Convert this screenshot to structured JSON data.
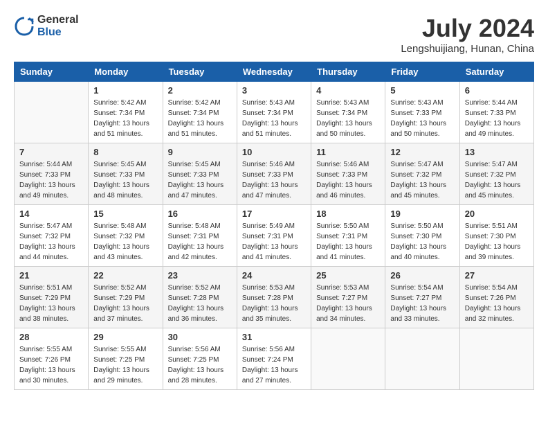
{
  "header": {
    "logo_general": "General",
    "logo_blue": "Blue",
    "month_year": "July 2024",
    "location": "Lengshuijiang, Hunan, China"
  },
  "weekdays": [
    "Sunday",
    "Monday",
    "Tuesday",
    "Wednesday",
    "Thursday",
    "Friday",
    "Saturday"
  ],
  "weeks": [
    [
      {
        "num": "",
        "sunrise": "",
        "sunset": "",
        "daylight": ""
      },
      {
        "num": "1",
        "sunrise": "Sunrise: 5:42 AM",
        "sunset": "Sunset: 7:34 PM",
        "daylight": "Daylight: 13 hours and 51 minutes."
      },
      {
        "num": "2",
        "sunrise": "Sunrise: 5:42 AM",
        "sunset": "Sunset: 7:34 PM",
        "daylight": "Daylight: 13 hours and 51 minutes."
      },
      {
        "num": "3",
        "sunrise": "Sunrise: 5:43 AM",
        "sunset": "Sunset: 7:34 PM",
        "daylight": "Daylight: 13 hours and 51 minutes."
      },
      {
        "num": "4",
        "sunrise": "Sunrise: 5:43 AM",
        "sunset": "Sunset: 7:34 PM",
        "daylight": "Daylight: 13 hours and 50 minutes."
      },
      {
        "num": "5",
        "sunrise": "Sunrise: 5:43 AM",
        "sunset": "Sunset: 7:33 PM",
        "daylight": "Daylight: 13 hours and 50 minutes."
      },
      {
        "num": "6",
        "sunrise": "Sunrise: 5:44 AM",
        "sunset": "Sunset: 7:33 PM",
        "daylight": "Daylight: 13 hours and 49 minutes."
      }
    ],
    [
      {
        "num": "7",
        "sunrise": "Sunrise: 5:44 AM",
        "sunset": "Sunset: 7:33 PM",
        "daylight": "Daylight: 13 hours and 49 minutes."
      },
      {
        "num": "8",
        "sunrise": "Sunrise: 5:45 AM",
        "sunset": "Sunset: 7:33 PM",
        "daylight": "Daylight: 13 hours and 48 minutes."
      },
      {
        "num": "9",
        "sunrise": "Sunrise: 5:45 AM",
        "sunset": "Sunset: 7:33 PM",
        "daylight": "Daylight: 13 hours and 47 minutes."
      },
      {
        "num": "10",
        "sunrise": "Sunrise: 5:46 AM",
        "sunset": "Sunset: 7:33 PM",
        "daylight": "Daylight: 13 hours and 47 minutes."
      },
      {
        "num": "11",
        "sunrise": "Sunrise: 5:46 AM",
        "sunset": "Sunset: 7:33 PM",
        "daylight": "Daylight: 13 hours and 46 minutes."
      },
      {
        "num": "12",
        "sunrise": "Sunrise: 5:47 AM",
        "sunset": "Sunset: 7:32 PM",
        "daylight": "Daylight: 13 hours and 45 minutes."
      },
      {
        "num": "13",
        "sunrise": "Sunrise: 5:47 AM",
        "sunset": "Sunset: 7:32 PM",
        "daylight": "Daylight: 13 hours and 45 minutes."
      }
    ],
    [
      {
        "num": "14",
        "sunrise": "Sunrise: 5:47 AM",
        "sunset": "Sunset: 7:32 PM",
        "daylight": "Daylight: 13 hours and 44 minutes."
      },
      {
        "num": "15",
        "sunrise": "Sunrise: 5:48 AM",
        "sunset": "Sunset: 7:32 PM",
        "daylight": "Daylight: 13 hours and 43 minutes."
      },
      {
        "num": "16",
        "sunrise": "Sunrise: 5:48 AM",
        "sunset": "Sunset: 7:31 PM",
        "daylight": "Daylight: 13 hours and 42 minutes."
      },
      {
        "num": "17",
        "sunrise": "Sunrise: 5:49 AM",
        "sunset": "Sunset: 7:31 PM",
        "daylight": "Daylight: 13 hours and 41 minutes."
      },
      {
        "num": "18",
        "sunrise": "Sunrise: 5:50 AM",
        "sunset": "Sunset: 7:31 PM",
        "daylight": "Daylight: 13 hours and 41 minutes."
      },
      {
        "num": "19",
        "sunrise": "Sunrise: 5:50 AM",
        "sunset": "Sunset: 7:30 PM",
        "daylight": "Daylight: 13 hours and 40 minutes."
      },
      {
        "num": "20",
        "sunrise": "Sunrise: 5:51 AM",
        "sunset": "Sunset: 7:30 PM",
        "daylight": "Daylight: 13 hours and 39 minutes."
      }
    ],
    [
      {
        "num": "21",
        "sunrise": "Sunrise: 5:51 AM",
        "sunset": "Sunset: 7:29 PM",
        "daylight": "Daylight: 13 hours and 38 minutes."
      },
      {
        "num": "22",
        "sunrise": "Sunrise: 5:52 AM",
        "sunset": "Sunset: 7:29 PM",
        "daylight": "Daylight: 13 hours and 37 minutes."
      },
      {
        "num": "23",
        "sunrise": "Sunrise: 5:52 AM",
        "sunset": "Sunset: 7:28 PM",
        "daylight": "Daylight: 13 hours and 36 minutes."
      },
      {
        "num": "24",
        "sunrise": "Sunrise: 5:53 AM",
        "sunset": "Sunset: 7:28 PM",
        "daylight": "Daylight: 13 hours and 35 minutes."
      },
      {
        "num": "25",
        "sunrise": "Sunrise: 5:53 AM",
        "sunset": "Sunset: 7:27 PM",
        "daylight": "Daylight: 13 hours and 34 minutes."
      },
      {
        "num": "26",
        "sunrise": "Sunrise: 5:54 AM",
        "sunset": "Sunset: 7:27 PM",
        "daylight": "Daylight: 13 hours and 33 minutes."
      },
      {
        "num": "27",
        "sunrise": "Sunrise: 5:54 AM",
        "sunset": "Sunset: 7:26 PM",
        "daylight": "Daylight: 13 hours and 32 minutes."
      }
    ],
    [
      {
        "num": "28",
        "sunrise": "Sunrise: 5:55 AM",
        "sunset": "Sunset: 7:26 PM",
        "daylight": "Daylight: 13 hours and 30 minutes."
      },
      {
        "num": "29",
        "sunrise": "Sunrise: 5:55 AM",
        "sunset": "Sunset: 7:25 PM",
        "daylight": "Daylight: 13 hours and 29 minutes."
      },
      {
        "num": "30",
        "sunrise": "Sunrise: 5:56 AM",
        "sunset": "Sunset: 7:25 PM",
        "daylight": "Daylight: 13 hours and 28 minutes."
      },
      {
        "num": "31",
        "sunrise": "Sunrise: 5:56 AM",
        "sunset": "Sunset: 7:24 PM",
        "daylight": "Daylight: 13 hours and 27 minutes."
      },
      {
        "num": "",
        "sunrise": "",
        "sunset": "",
        "daylight": ""
      },
      {
        "num": "",
        "sunrise": "",
        "sunset": "",
        "daylight": ""
      },
      {
        "num": "",
        "sunrise": "",
        "sunset": "",
        "daylight": ""
      }
    ]
  ]
}
